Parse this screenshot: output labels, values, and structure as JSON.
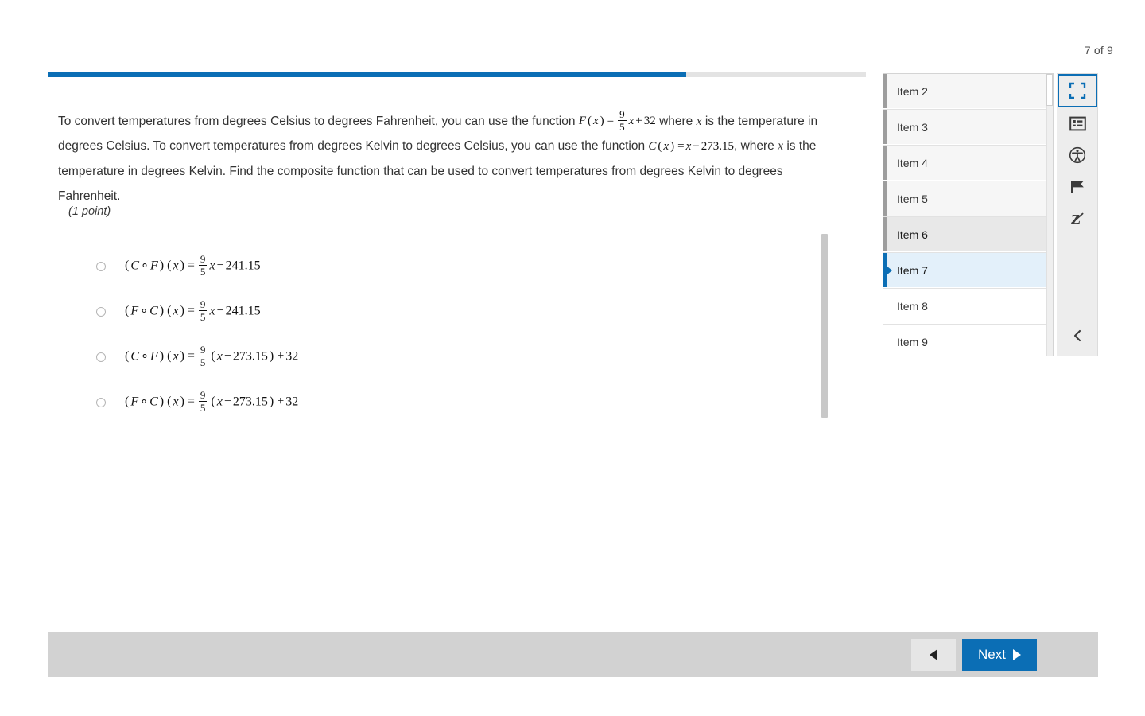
{
  "header": {
    "page_counter": "7 of 9"
  },
  "progress": {
    "percent": 78,
    "fill_color": "#0b6eb5",
    "track_color": "#e3e3e3"
  },
  "question": {
    "paragraph_part1": "To convert temperatures from degrees Celsius to degrees Fahrenheit, you can use the function",
    "formula_F": "F(x) = 9/5 x + 32",
    "paragraph_part2": "where",
    "var_x_1": "x",
    "paragraph_part3": "is the temperature in degrees Celsius. To convert temperatures from degrees Kelvin to degrees Celsius, you can use the function",
    "formula_C": "C(x) = x − 273.15",
    "paragraph_part4": ", where",
    "var_x_2": "x",
    "paragraph_part5": "is the temperature in degrees Kelvin. Find the composite function that can be used to convert temperatures from degrees Kelvin to degrees Fahrenheit.",
    "points_label": "(1 point)"
  },
  "options": [
    {
      "id": "option-a",
      "selected": false,
      "latex": "(C∘F)(x) = 9/5 x − 241.15",
      "lhs_left": "C",
      "lhs_right": "F",
      "num": "9",
      "den": "5",
      "tail": "x − 241.15",
      "form": "linear"
    },
    {
      "id": "option-b",
      "selected": false,
      "latex": "(F∘C)(x) = 9/5 x − 241.15",
      "lhs_left": "F",
      "lhs_right": "C",
      "num": "9",
      "den": "5",
      "tail": "x − 241.15",
      "form": "linear"
    },
    {
      "id": "option-c",
      "selected": false,
      "latex": "(C∘F)(x) = 9/5 (x − 273.15) + 32",
      "lhs_left": "C",
      "lhs_right": "F",
      "num": "9",
      "den": "5",
      "tail": "(x − 273.15) + 32",
      "form": "paren"
    },
    {
      "id": "option-d",
      "selected": false,
      "latex": "(F∘C)(x) = 9/5 (x − 273.15) + 32",
      "lhs_left": "F",
      "lhs_right": "C",
      "num": "9",
      "den": "5",
      "tail": "(x − 273.15) + 32",
      "form": "paren"
    }
  ],
  "navigator": {
    "items": [
      {
        "label": "Item 2",
        "state": "seen"
      },
      {
        "label": "Item 3",
        "state": "seen"
      },
      {
        "label": "Item 4",
        "state": "seen"
      },
      {
        "label": "Item 5",
        "state": "seen"
      },
      {
        "label": "Item 6",
        "state": "hovered"
      },
      {
        "label": "Item 7",
        "state": "current"
      },
      {
        "label": "Item 8",
        "state": "unseen"
      },
      {
        "label": "Item 9",
        "state": "unseen"
      }
    ]
  },
  "toolbar": {
    "buttons": [
      {
        "icon": "fullscreen-icon",
        "label": "Expand",
        "active": true
      },
      {
        "icon": "reference-panel-icon",
        "label": "Reference",
        "active": false
      },
      {
        "icon": "accessibility-icon",
        "label": "Accessibility",
        "active": false
      },
      {
        "icon": "flag-icon",
        "label": "Flag for review",
        "active": false
      },
      {
        "icon": "strikethrough-answer-icon",
        "label": "Answer eliminator",
        "active": false
      }
    ],
    "collapse": {
      "icon": "chevron-left-icon",
      "label": "Collapse"
    }
  },
  "footer": {
    "prev_label": "",
    "next_label": "Next",
    "next_color": "#0b6eb5"
  },
  "colors": {
    "accent": "#0b6eb5",
    "current_row_bg": "#e3f0fa",
    "hover_row_bg": "#e8e8e8",
    "seen_row_bg": "#f6f6f6",
    "footer_bg": "#d2d2d2",
    "rail_bg": "#ededed"
  }
}
